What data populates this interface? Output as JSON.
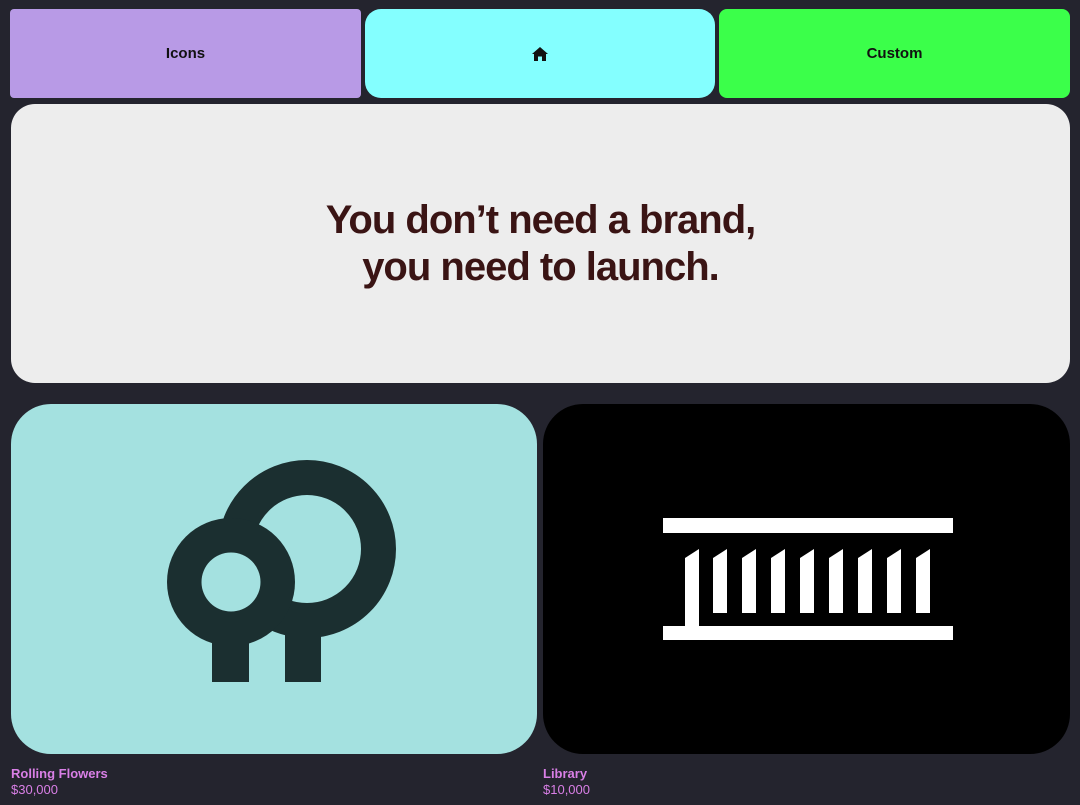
{
  "nav": {
    "icons_label": "Icons",
    "home_icon": "home-icon",
    "custom_label": "Custom",
    "colors": {
      "icons": "#b89ae6",
      "home": "#84ffff",
      "custom": "#3bff4a"
    }
  },
  "hero": {
    "headline": "You don’t need a brand,\nyou need to launch."
  },
  "products": [
    {
      "title": "Rolling Flowers",
      "price": "$30,000",
      "logo_icon": "rolling-flowers-logo",
      "bg_color": "#a4e1e0",
      "fg_color": "#1b2f30",
      "label_color": "#d97fe6"
    },
    {
      "title": "Library",
      "price": "$10,000",
      "logo_icon": "library-logo",
      "bg_color": "#000000",
      "fg_color": "#ffffff",
      "label_color": "#d97fe6"
    }
  ]
}
